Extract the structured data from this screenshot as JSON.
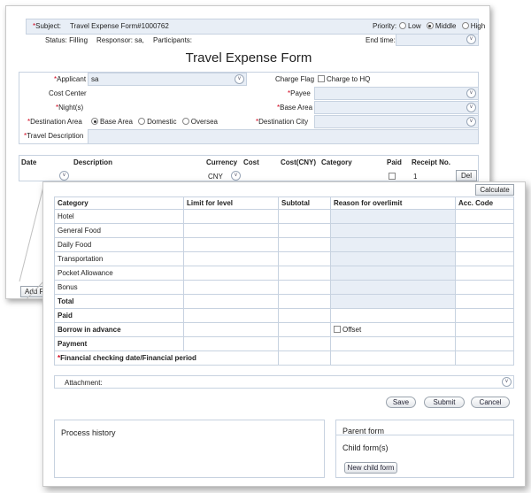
{
  "header": {
    "subject_label": "Subject:",
    "subject_value": "Travel Expense Form#1000762",
    "priority_label": "Priority:",
    "priority_options": [
      "Low",
      "Middle",
      "High"
    ],
    "priority_selected": "Middle",
    "status_text": "Status: Filling",
    "responsor_text": "Responsor: sa,",
    "participants_label": "Participants:",
    "end_time_label": "End time:"
  },
  "form_title": "Travel Expense Form",
  "fields": {
    "applicant_label": "Applicant",
    "applicant_value": "sa",
    "charge_flag_label": "Charge Flag",
    "charge_to_hq_label": "Charge to HQ",
    "cost_center_label": "Cost Center",
    "payee_label": "Payee",
    "nights_label": "Night(s)",
    "base_area_label": "Base Area",
    "destination_area_label": "Destination Area",
    "destination_area_options": [
      "Base Area",
      "Domestic",
      "Oversea"
    ],
    "destination_area_selected": "Base Area",
    "destination_city_label": "Destination City",
    "travel_description_label": "Travel Description",
    "required_mark": "*"
  },
  "expense_table": {
    "headers": [
      "Date",
      "Description",
      "Currency",
      "Cost",
      "Cost(CNY)",
      "Category",
      "Paid",
      "Receipt No."
    ],
    "row": {
      "currency": "CNY",
      "receipt": "1",
      "del_label": "Del"
    },
    "add_row_label": "Add Ro"
  },
  "summary": {
    "calculate_label": "Calculate",
    "headers": [
      "Category",
      "Limit for level",
      "Subtotal",
      "Reason for overlimit",
      "Acc. Code"
    ],
    "rows": [
      "Hotel",
      "General Food",
      "Daily Food",
      "Transportation",
      "Pocket Allowance",
      "Bonus",
      "Total",
      "Paid",
      "Borrow in advance",
      "Payment"
    ],
    "offset_label": "Offset",
    "financial_label": "Financial checking date/Financial period"
  },
  "attachment_label": "Attachment:",
  "actions": {
    "save": "Save",
    "submit": "Submit",
    "cancel": "Cancel"
  },
  "process_history_label": "Process history",
  "parent_form_label": "Parent form",
  "child_forms_label": "Child form(s)",
  "new_child_form_label": "New child form"
}
